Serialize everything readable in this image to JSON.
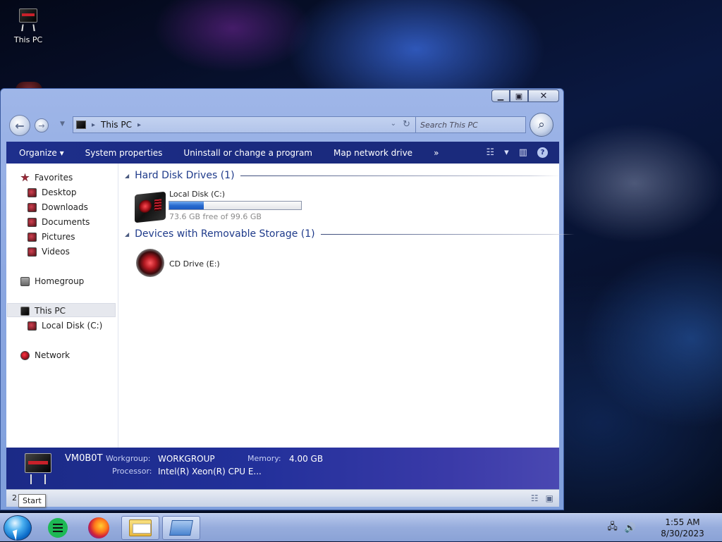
{
  "desktop": {
    "icon_label": "This PC"
  },
  "window": {
    "address": {
      "crumb": "This PC"
    },
    "search": {
      "placeholder": "Search This PC"
    },
    "toolbar": {
      "organize": "Organize",
      "system_properties": "System properties",
      "uninstall": "Uninstall or change a program",
      "map_drive": "Map network drive",
      "more": "»"
    },
    "nav": {
      "favorites": "Favorites",
      "desktop": "Desktop",
      "downloads": "Downloads",
      "documents": "Documents",
      "pictures": "Pictures",
      "videos": "Videos",
      "homegroup": "Homegroup",
      "this_pc": "This PC",
      "local_disk": "Local Disk (C:)",
      "network": "Network"
    },
    "groups": {
      "hdd": "Hard Disk Drives (1)",
      "removable": "Devices with Removable Storage (1)"
    },
    "drives": {
      "c_name": "Local Disk (C:)",
      "c_free": "73.6 GB free of 99.6 GB",
      "c_used_fraction": 0.26,
      "e_name": "CD Drive (E:)"
    },
    "details": {
      "computer_name": "VM0B0T",
      "workgroup_label": "Workgroup:",
      "workgroup_value": "WORKGROUP",
      "memory_label": "Memory:",
      "memory_value": "4.00 GB",
      "processor_label": "Processor:",
      "processor_value": "Intel(R) Xeon(R) CPU E..."
    },
    "status": {
      "count": "2"
    }
  },
  "tooltip": "Start",
  "taskbar": {
    "time": "1:55 AM",
    "date": "8/30/2023"
  },
  "icons": {
    "back": "back-arrow-icon",
    "forward": "forward-arrow-icon",
    "search": "search-icon",
    "refresh": "refresh-icon",
    "help": "help-icon"
  },
  "colors": {
    "toolbar": "#1e2f8c",
    "group_heading": "#1e3a8a",
    "progress_fill": "#2a6cd0"
  }
}
